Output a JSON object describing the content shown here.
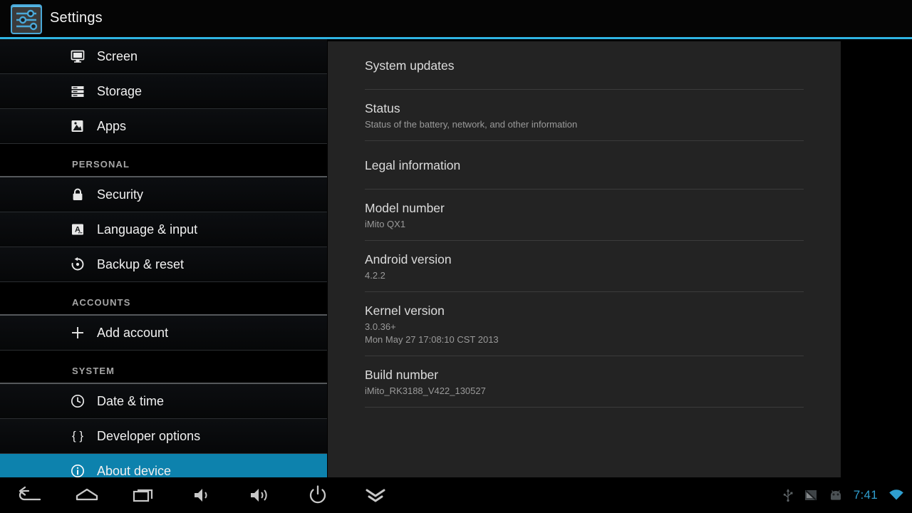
{
  "titlebar": {
    "app_title": "Settings",
    "app_icon": "settings-sliders-icon",
    "accent_color": "#2fb5e3"
  },
  "sidebar": {
    "highlight_color": "#0d82ad",
    "items": [
      {
        "type": "item",
        "label": "Screen",
        "icon": "monitor-icon",
        "selected": false
      },
      {
        "type": "item",
        "label": "Storage",
        "icon": "storage-bars-icon",
        "selected": false
      },
      {
        "type": "item",
        "label": "Apps",
        "icon": "apps-image-icon",
        "selected": false
      },
      {
        "type": "section",
        "label": "PERSONAL"
      },
      {
        "type": "item",
        "label": "Security",
        "icon": "lock-icon",
        "selected": false
      },
      {
        "type": "item",
        "label": "Language & input",
        "icon": "language-a-icon",
        "selected": false
      },
      {
        "type": "item",
        "label": "Backup & reset",
        "icon": "backup-restore-icon",
        "selected": false
      },
      {
        "type": "section",
        "label": "ACCOUNTS"
      },
      {
        "type": "item",
        "label": "Add account",
        "icon": "plus-icon",
        "selected": false
      },
      {
        "type": "section",
        "label": "SYSTEM"
      },
      {
        "type": "item",
        "label": "Date & time",
        "icon": "clock-icon",
        "selected": false
      },
      {
        "type": "item",
        "label": "Developer options",
        "icon": "braces-icon",
        "selected": false
      },
      {
        "type": "item",
        "label": "About device",
        "icon": "info-circle-icon",
        "selected": true
      }
    ]
  },
  "panel": {
    "prefs": [
      {
        "title": "System updates",
        "sub": ""
      },
      {
        "title": "Status",
        "sub": "Status of the battery, network, and other information"
      },
      {
        "title": "Legal information",
        "sub": ""
      },
      {
        "title": "Model number",
        "sub": "iMito QX1"
      },
      {
        "title": "Android version",
        "sub": "4.2.2"
      },
      {
        "title": "Kernel version",
        "sub": "3.0.36+\nMon May 27 17:08:10 CST 2013"
      },
      {
        "title": "Build number",
        "sub": "iMito_RK3188_V422_130527"
      }
    ]
  },
  "sysbar": {
    "navkeys": [
      {
        "name": "back-icon"
      },
      {
        "name": "home-icon"
      },
      {
        "name": "recents-icon"
      },
      {
        "name": "volume-down-icon"
      },
      {
        "name": "volume-up-icon"
      },
      {
        "name": "power-icon"
      },
      {
        "name": "hide-navbar-chevron-icon"
      }
    ],
    "status_icons": [
      {
        "name": "usb-icon"
      },
      {
        "name": "no-signal-icon"
      },
      {
        "name": "android-robot-icon"
      }
    ],
    "clock": "7:41",
    "clock_color": "#2f9fd0",
    "wifi_icon": "wifi-icon"
  }
}
